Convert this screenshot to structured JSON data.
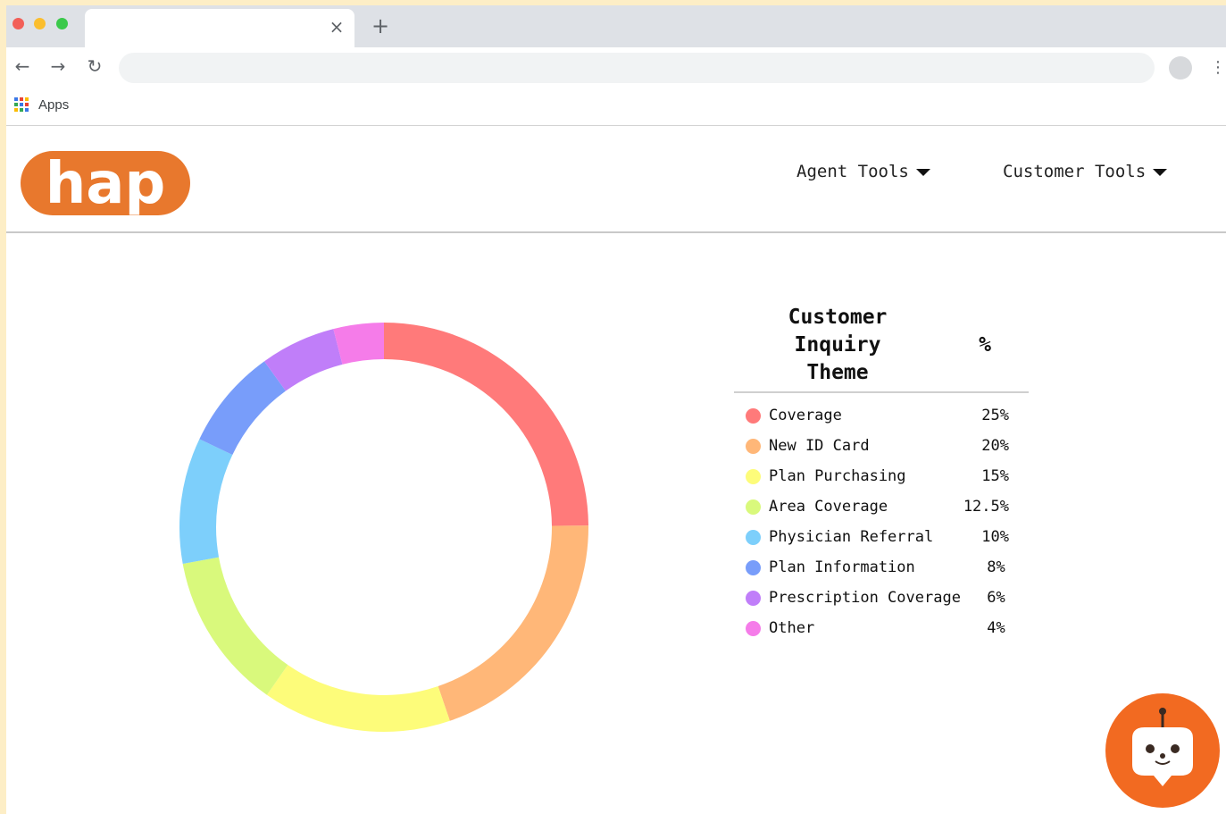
{
  "browser": {
    "tab_close_glyph": "×",
    "new_tab_glyph": "+",
    "back_glyph": "←",
    "forward_glyph": "→",
    "reload_glyph": "↻",
    "menu_glyph": "⋮",
    "bookmarks": {
      "apps_label": "Apps"
    }
  },
  "header": {
    "logo_text": "hap",
    "nav": [
      {
        "label": "Agent Tools"
      },
      {
        "label": "Customer Tools"
      }
    ]
  },
  "legend": {
    "header_theme_lines": [
      "Customer",
      "Inquiry",
      "Theme"
    ],
    "header_pct": "%"
  },
  "chart_data": {
    "type": "pie",
    "donut": true,
    "categories": [
      "Coverage",
      "New ID Card",
      "Plan Purchasing",
      "Area Coverage",
      "Physician Referral",
      "Plan Information",
      "Prescription Coverage",
      "Other"
    ],
    "values": [
      25,
      20,
      15,
      12.5,
      10,
      8,
      6,
      4
    ],
    "value_labels": [
      "25%",
      "20%",
      "15%",
      "12.5%",
      "10%",
      "8%",
      "6%",
      "4%"
    ],
    "colors": [
      "#ff7a7a",
      "#ffb778",
      "#fdfc7a",
      "#d9f97c",
      "#7dcffb",
      "#789dfa",
      "#c07ef9",
      "#f57ce9"
    ],
    "legend_placement": "right",
    "title": ""
  },
  "colors": {
    "brand_orange": "#e8782d",
    "chatbot_orange": "#f26a21"
  },
  "icons": {
    "chatbot": "robot-chat-icon",
    "apps": "apps-grid-icon"
  }
}
